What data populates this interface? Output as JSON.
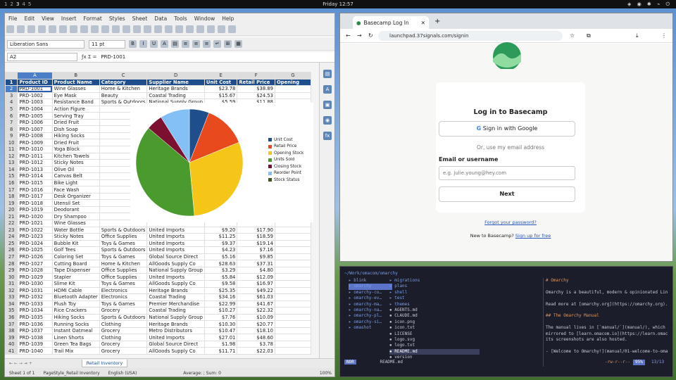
{
  "topbar": {
    "workspaces": [
      "1",
      "2",
      "3",
      "4",
      "5"
    ],
    "active_workspace": "3",
    "clock": "Friday 12:57",
    "tray": "◈ ◉ ✱ ⌁ ⏻"
  },
  "calc": {
    "menu": [
      "File",
      "Edit",
      "View",
      "Insert",
      "Format",
      "Styles",
      "Sheet",
      "Data",
      "Tools",
      "Window",
      "Help"
    ],
    "font_name": "Liberation Sans",
    "font_size": "11 pt",
    "cell_ref": "A2",
    "formula": "PRD-1001",
    "columns": [
      "A",
      "B",
      "C",
      "D",
      "E",
      "F",
      "G"
    ],
    "headers": [
      "Product ID",
      "Product Name",
      "Category",
      "Supplier Name",
      "Unit Cost",
      "Retail Price",
      "Opening"
    ],
    "rows": [
      [
        "PRD-1001",
        "Wine Glasses",
        "Home & Kitchen",
        "Heritage Brands",
        "$23.78",
        "$38.89"
      ],
      [
        "PRD-1002",
        "Eye Mask",
        "Beauty",
        "Coastal Trading",
        "$15.67",
        "$24.53"
      ],
      [
        "PRD-1003",
        "Resistance Band",
        "Sports & Outdoors",
        "National Supply Group",
        "$5.59",
        "$11.88"
      ],
      [
        "PRD-1004",
        "Action Figure",
        "",
        "",
        "",
        ""
      ],
      [
        "PRD-1005",
        "Serving Tray",
        "",
        "",
        "",
        ""
      ],
      [
        "PRD-1006",
        "Dried Fruit",
        "",
        "",
        "",
        ""
      ],
      [
        "PRD-1007",
        "Dish Soap",
        "",
        "",
        "",
        ""
      ],
      [
        "PRD-1008",
        "Hiking Socks",
        "",
        "",
        "",
        ""
      ],
      [
        "PRD-1009",
        "Dried Fruit",
        "",
        "",
        "",
        ""
      ],
      [
        "PRD-1010",
        "Yoga Block",
        "",
        "",
        "",
        ""
      ],
      [
        "PRD-1011",
        "Kitchen Towels",
        "",
        "",
        "",
        ""
      ],
      [
        "PRD-1012",
        "Sticky Notes",
        "",
        "",
        "",
        ""
      ],
      [
        "PRD-1013",
        "Olive Oil",
        "",
        "",
        "",
        ""
      ],
      [
        "PRD-1014",
        "Canvas Belt",
        "",
        "",
        "",
        ""
      ],
      [
        "PRD-1015",
        "Bike Light",
        "",
        "",
        "",
        ""
      ],
      [
        "PRD-1016",
        "Face Wash",
        "",
        "",
        "",
        ""
      ],
      [
        "PRD-1017",
        "Desk Organizer",
        "",
        "",
        "",
        ""
      ],
      [
        "PRD-1018",
        "Utensil Set",
        "",
        "",
        "",
        ""
      ],
      [
        "PRD-1019",
        "Deodorant",
        "",
        "",
        "",
        ""
      ],
      [
        "PRD-1020",
        "Dry Shampoo",
        "",
        "",
        "",
        ""
      ],
      [
        "PRD-1021",
        "Wine Glasses",
        "",
        "",
        "",
        ""
      ],
      [
        "PRD-1022",
        "Water Bottle",
        "Sports & Outdoors",
        "United Imports",
        "$9.20",
        "$17.90"
      ],
      [
        "PRD-1023",
        "Sticky Notes",
        "Office Supplies",
        "United Imports",
        "$11.25",
        "$18.59"
      ],
      [
        "PRD-1024",
        "Bubble Kit",
        "Toys & Games",
        "United Imports",
        "$9.37",
        "$19.14"
      ],
      [
        "PRD-1025",
        "Golf Tees",
        "Sports & Outdoors",
        "United Imports",
        "$4.23",
        "$7.16"
      ],
      [
        "PRD-1026",
        "Coloring Set",
        "Toys & Games",
        "Global Source Direct",
        "$5.16",
        "$9.85"
      ],
      [
        "PRD-1027",
        "Cutting Board",
        "Home & Kitchen",
        "AllGoods Supply Co",
        "$28.63",
        "$37.31"
      ],
      [
        "PRD-1028",
        "Tape Dispenser",
        "Office Supplies",
        "National Supply Group",
        "$3.29",
        "$4.80"
      ],
      [
        "PRD-1029",
        "Stapler",
        "Office Supplies",
        "United Imports",
        "$5.84",
        "$12.09"
      ],
      [
        "PRD-1030",
        "Slime Kit",
        "Toys & Games",
        "AllGoods Supply Co",
        "$9.58",
        "$16.97"
      ],
      [
        "PRD-1031",
        "HDMI Cable",
        "Electronics",
        "Heritage Brands",
        "$25.35",
        "$49.22"
      ],
      [
        "PRD-1032",
        "Bluetooth Adapter",
        "Electronics",
        "Coastal Trading",
        "$34.16",
        "$61.03"
      ],
      [
        "PRD-1033",
        "Plush Toy",
        "Toys & Games",
        "Premier Merchandise",
        "$22.99",
        "$41.67"
      ],
      [
        "PRD-1034",
        "Rice Crackers",
        "Grocery",
        "Coastal Trading",
        "$10.27",
        "$22.32"
      ],
      [
        "PRD-1035",
        "Hiking Socks",
        "Sports & Outdoors",
        "National Supply Group",
        "$7.76",
        "$10.09"
      ],
      [
        "PRD-1036",
        "Running Socks",
        "Clothing",
        "Heritage Brands",
        "$10.30",
        "$20.77"
      ],
      [
        "PRD-1037",
        "Instant Oatmeal",
        "Grocery",
        "Metro Distributors",
        "$10.47",
        "$18.10"
      ],
      [
        "PRD-1038",
        "Linen Shorts",
        "Clothing",
        "United Imports",
        "$27.01",
        "$48.60"
      ],
      [
        "PRD-1039",
        "Green Tea Bags",
        "Grocery",
        "Global Source Direct",
        "$1.98",
        "$3.78"
      ],
      [
        "PRD-1040",
        "Trail Mix",
        "Grocery",
        "AllGoods Supply Co",
        "$11.71",
        "$22.03"
      ],
      [
        "PRD-1041",
        "Action Figure",
        "Toys & Games",
        "Heritage Brands",
        "$23.76",
        "$47.93"
      ]
    ],
    "sheet_tab": "Retail Inventory",
    "status": [
      "Sheet 1 of 1",
      "PageStyle_Retail Inventory",
      "English (USA)",
      "Average: ; Sum: 0",
      "100%"
    ]
  },
  "chart_data": {
    "type": "pie",
    "legend": [
      "Unit Cost",
      "Retail Price",
      "Opening Stock",
      "Units Sold",
      "Closing Stock",
      "Reorder Point",
      "Stock Status"
    ],
    "values": [
      6,
      13,
      30,
      38,
      5,
      9,
      0
    ],
    "colors": [
      "#1f4e8c",
      "#e8491d",
      "#f5c518",
      "#4a9a2e",
      "#7b1030",
      "#84c0f5",
      "#3a5a20"
    ],
    "legend_position": "right"
  },
  "browser": {
    "tab_title": "Basecamp Log In",
    "url": "launchpad.37signals.com/signin",
    "heading": "Log in to Basecamp",
    "google_btn": "Sign in with Google",
    "divider": "Or, use my email address",
    "email_label": "Email or username",
    "email_placeholder": "e.g. julie.young@hey.com",
    "next_btn": "Next",
    "forgot": "Forgot your password?",
    "new_text": "New to Basecamp?",
    "signup": "Sign up for free"
  },
  "terminal": {
    "path": "~/Work/omacom/omarchy",
    "tree1": [
      "blink",
      "omarchy",
      "omarchy-co…",
      "omarchy-ev…",
      "omarchy-ma…",
      "omarchy-na…",
      "omarchy-pl…",
      "omarchy-si…",
      "omashot"
    ],
    "tree2": [
      "migrations",
      "plans",
      "shell",
      "test",
      "themes",
      "AGENTS.md",
      "CLAUDE.md",
      "icon.png",
      "icon.txt",
      "LICENSE",
      "logo.svg",
      "logo.txt",
      "README.md",
      "version"
    ],
    "preview": [
      "# Omarchy",
      "",
      "Omarchy is a beautiful, modern & opinionated Lin",
      "",
      "Read more at [omarchy.org](https://omarchy.org).",
      "",
      "## The Omarchy Manual",
      "",
      "The manual lives in [`manual/`](manual/), which",
      "mirrored to [learn.omacom.io](https://learn.omac",
      "its screenshots are also hosted.",
      "",
      "- [Welcome to Omarchy!](manual/01-welcome-to-oma"
    ],
    "mode": "NOR",
    "status_file": "README.md",
    "status_right": "-rw-r--r--",
    "progress": "95%",
    "count": "13/13"
  }
}
